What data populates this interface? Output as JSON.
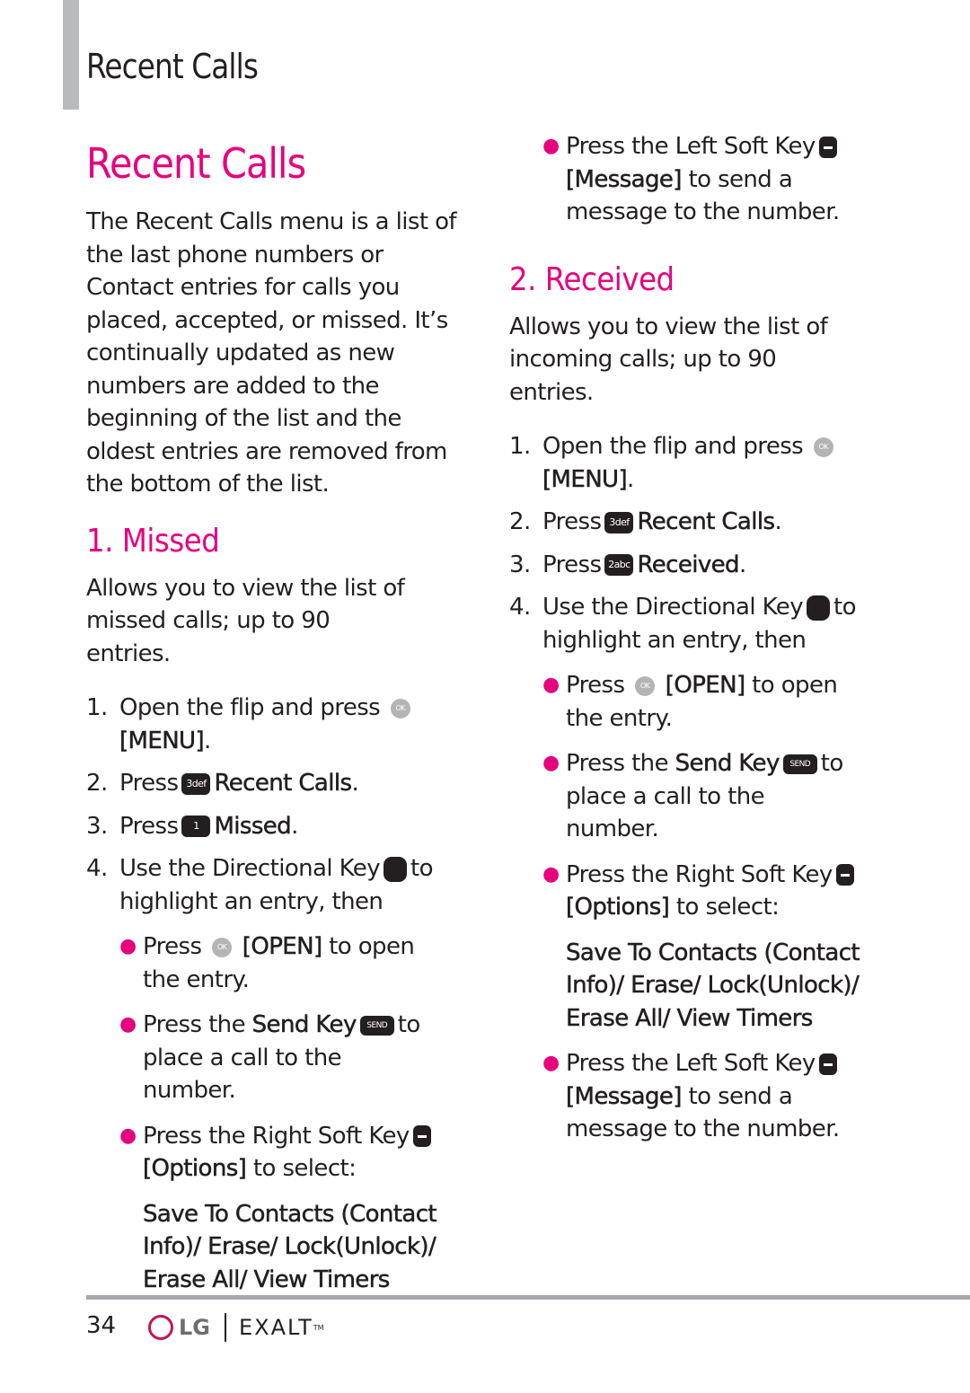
{
  "header": {
    "section_title": "Recent Calls"
  },
  "colors": {
    "accent": "#e6007e",
    "text": "#231f20",
    "tab_bar": "#b8babd"
  },
  "main": {
    "title": "Recent Calls",
    "intro": "The Recent Calls menu is a list of the last phone numbers or Contact entries for calls you placed, accepted, or missed. It’s continually updated as new numbers are added to the beginning of the list and the oldest entries are removed from the bottom of the list.",
    "missed": {
      "heading": "1. Missed",
      "desc": "Allows you to view the list of missed calls; up to 90 entries.",
      "steps": [
        {
          "num": "1.",
          "pre": "Open the flip and press",
          "key": "OK",
          "post": "",
          "bold": "[MENU]",
          "end": "."
        },
        {
          "num": "2.",
          "pre": "Press",
          "key": "3 def",
          "bold": "Recent Calls",
          "end": "."
        },
        {
          "num": "3.",
          "pre": "Press",
          "key": "1",
          "bold": "Missed",
          "end": "."
        },
        {
          "num": "4.",
          "pre": "Use the Directional Key",
          "post": "to highlight an entry, then"
        }
      ],
      "bullets": [
        {
          "pre": "Press",
          "key": "OK",
          "bold": "[OPEN]",
          "post": "to open the entry."
        },
        {
          "pre": "Press the",
          "bold": "Send Key",
          "key": "SEND",
          "post": "to place a call to the number."
        },
        {
          "pre": "Press the Right Soft Key",
          "bold": "[Options]",
          "post": "to select:"
        }
      ],
      "options": "Save To Contacts (Contact Info)/ Erase/ Lock(Unlock)/ Erase All/ View Timers",
      "last_bullet": {
        "pre": "Press the Left Soft Key",
        "bold": "[Message]",
        "post": "to send a message to the number."
      }
    },
    "received": {
      "heading": "2. Received",
      "desc": "Allows you to view the list of incoming calls; up to 90 entries.",
      "steps": [
        {
          "num": "1.",
          "pre": "Open the flip and press",
          "key": "OK",
          "bold": "[MENU]",
          "end": "."
        },
        {
          "num": "2.",
          "pre": "Press",
          "key": "3 def",
          "bold": "Recent Calls",
          "end": "."
        },
        {
          "num": "3.",
          "pre": "Press",
          "key": "2 abc",
          "bold": "Received",
          "end": "."
        },
        {
          "num": "4.",
          "pre": "Use the Directional Key",
          "post": "to highlight an entry, then"
        }
      ],
      "bullets": [
        {
          "pre": "Press",
          "key": "OK",
          "bold": "[OPEN]",
          "post": "to open the entry."
        },
        {
          "pre": "Press the",
          "bold": "Send Key",
          "key": "SEND",
          "post": "to place a call to the number."
        },
        {
          "pre": "Press the Right Soft Key",
          "bold": "[Options]",
          "post": "to select:"
        }
      ],
      "options": "Save To Contacts (Contact Info)/ Erase/ Lock(Unlock)/ Erase All/ View Timers",
      "last_bullet": {
        "pre": "Press the Left Soft Key",
        "bold": "[Message]",
        "post": "to send a message to the number."
      }
    }
  },
  "footer": {
    "page_number": "34",
    "brand": "LG",
    "product": "EXALT",
    "tm": "TM"
  }
}
